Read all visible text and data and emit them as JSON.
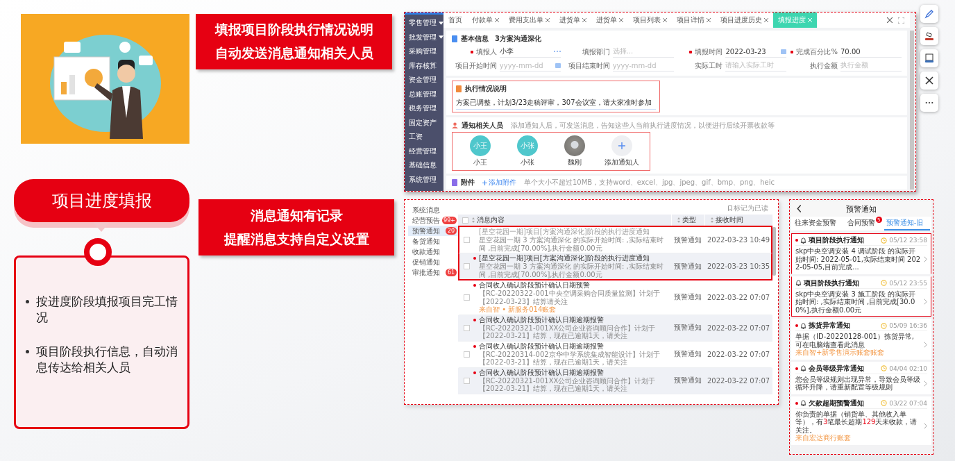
{
  "feature": {
    "title": "项目进度填报",
    "bullets": [
      "按进度阶段填报项目完工情况",
      "项目阶段执行信息，自动消息传达给相关人员"
    ]
  },
  "callouts": [
    {
      "lines": [
        "填报项目阶段执行情况说明",
        "自动发送消息通知相关人员"
      ]
    },
    {
      "lines": [
        "消息通知有记录",
        "提醒消息支持自定义设置"
      ]
    }
  ],
  "progress_app": {
    "sidebar": [
      {
        "label": "零售管理",
        "expandable": true
      },
      {
        "label": "批发管理",
        "expandable": true
      },
      {
        "label": "采购管理",
        "expandable": false
      },
      {
        "label": "库存核算",
        "expandable": false
      },
      {
        "label": "资金管理",
        "expandable": false
      },
      {
        "label": "总账管理",
        "expandable": false
      },
      {
        "label": "税务管理",
        "expandable": false
      },
      {
        "label": "固定资产",
        "expandable": false
      },
      {
        "label": "工资",
        "expandable": false
      },
      {
        "label": "经营管理",
        "expandable": false
      },
      {
        "label": "基础信息",
        "expandable": false
      },
      {
        "label": "系统管理",
        "expandable": false
      }
    ],
    "tabs": [
      {
        "label": "首页",
        "closable": false,
        "selected": false
      },
      {
        "label": "付款单",
        "closable": true,
        "selected": false
      },
      {
        "label": "费用支出单",
        "closable": true,
        "selected": false
      },
      {
        "label": "进货单",
        "closable": true,
        "selected": false
      },
      {
        "label": "进货单",
        "closable": true,
        "selected": false
      },
      {
        "label": "项目列表",
        "closable": true,
        "selected": false
      },
      {
        "label": "项目详情",
        "closable": true,
        "selected": false
      },
      {
        "label": "项目进度历史",
        "closable": true,
        "selected": false
      },
      {
        "label": "填报进度",
        "closable": true,
        "selected": true
      }
    ],
    "basic_info": {
      "title": "基本信息",
      "project": "3方案沟通深化",
      "fields": [
        {
          "label": "填报人",
          "required": true,
          "value": "小李",
          "kind": "picker"
        },
        {
          "label": "填报部门",
          "required": false,
          "placeholder": "选择...",
          "kind": "text"
        },
        {
          "label": "填报时间",
          "required": true,
          "value": "2022-03-23",
          "kind": "date"
        },
        {
          "label": "完成百分比%",
          "required": true,
          "value": "70.00",
          "kind": "text"
        },
        {
          "label": "项目开始时间",
          "required": false,
          "placeholder": "yyyy-mm-dd",
          "kind": "date"
        },
        {
          "label": "项目结束时间",
          "required": false,
          "placeholder": "yyyy-mm-dd",
          "kind": "text"
        },
        {
          "label": "实际工时",
          "required": false,
          "placeholder": "请输入实际工时",
          "kind": "text"
        },
        {
          "label": "执行金额",
          "required": false,
          "placeholder": "执行金额",
          "kind": "text"
        }
      ]
    },
    "execution": {
      "title": "执行情况说明",
      "text": "方案已调整，计划3/23走稿评审，307会议室，请大家准时参加",
      "highlighted": true
    },
    "notify": {
      "title": "通知相关人员",
      "hint": "添加通知人后，可发送消息，告知这些人当前执行进度情况，以便进行后续开票收款等",
      "highlighted": true,
      "people": [
        {
          "kind": "initials",
          "avatar": "小王",
          "name": "小王"
        },
        {
          "kind": "initials",
          "avatar": "小张",
          "name": "小张"
        },
        {
          "kind": "photo",
          "name": "魏刚"
        },
        {
          "kind": "add",
          "name": "添加通知人"
        }
      ]
    },
    "attachments": {
      "title": "附件",
      "link": "添加附件",
      "hint": "单个大小不超过10MB，支持word、excel、jpg、jpeg、gif、bmp、png、heic"
    }
  },
  "messages_app": {
    "sidebar": [
      {
        "label": "系统消息",
        "selected": false
      },
      {
        "label": "经营预告",
        "badge": "99+",
        "selected": false
      },
      {
        "label": "预警通知",
        "badge": "20",
        "selected": true
      },
      {
        "label": "备货通知",
        "selected": false
      },
      {
        "label": "收款通知",
        "selected": false
      },
      {
        "label": "促销通知",
        "selected": false
      },
      {
        "label": "审批通知",
        "badge": "61",
        "selected": false
      }
    ],
    "mark_read": "标记为已读",
    "all_checked": false,
    "columns": [
      "消息内容",
      "类型",
      "接收时间"
    ],
    "rows": [
      {
        "unread": false,
        "checked": false,
        "highlighted": true,
        "title": "[星空花园一期]项目[方案沟通深化]阶段的执行进度通知",
        "body": "星空花园一期 3 方案沟通深化 的实际开始时间: ,实际结束时间 ,目前完成[70.00%],执行金额0.00元",
        "type": "预警通知",
        "time": "2022-03-23 10:49"
      },
      {
        "unread": true,
        "checked": false,
        "highlighted": true,
        "title": "[星空花园一期]项目[方案沟通深化]阶段的执行进度通知",
        "body": "星空花园一期 3 方案沟通深化 的实际开始时间: ,实际结束时间 ,目前完成[70.00%],执行金额0.00元",
        "type": "预警通知",
        "time": "2022-03-23 10:35"
      },
      {
        "unread": true,
        "checked": false,
        "highlighted": false,
        "title": "合同收入确认阶段预计确认日期预警",
        "body": "【RC-20220322-001中央空调采购合同质量监测】计划于【2022-03-23】结算请关注",
        "source": "来自智 • 新服务014账套",
        "type": "预警通知",
        "time": "2022-03-22 07:07"
      },
      {
        "unread": true,
        "checked": false,
        "highlighted": false,
        "title": "合同收入确认阶段预计确认日期逾期报警",
        "body": "【RC-20220321-001XX公司企业咨询顾问合作】计划于【2022-03-21】结算，现在已逾期1天，请关注",
        "type": "预警通知",
        "time": "2022-03-22 07:07"
      },
      {
        "unread": true,
        "checked": false,
        "highlighted": false,
        "title": "合同收入确认阶段预计确认日期逾期报警",
        "body": "【RC-20220314-002京华中学系统集成智能设计】计划于【2022-03-21】结算，现在已逾期1天，请关注",
        "type": "预警通知",
        "time": "2022-03-22 07:07"
      },
      {
        "unread": true,
        "checked": false,
        "highlighted": false,
        "title": "合同收入确认阶段预计确认日期逾期报警",
        "body": "【RC-20220321-001XX公司企业咨询顾问合作】计划于【2022-03-21】结算，现在已逾期1天，请关注",
        "type": "预警通知",
        "time": "2022-03-22 07:07"
      }
    ]
  },
  "phone": {
    "title": "预警通知",
    "tabs": [
      {
        "label": "往来资金预警",
        "selected": false
      },
      {
        "label": "合同预警",
        "badge": "5",
        "selected": false
      },
      {
        "label": "预警通知-旧",
        "selected": true
      }
    ],
    "items": [
      {
        "unread": true,
        "highlighted": true,
        "title": "项目阶段执行通知",
        "time": "05/12 23:58",
        "body": "skp中央空调安装 4 调试阶段 的实际开始时间: 2022-05-01,实际结束时间 2022-05-05,目前完成..."
      },
      {
        "unread": false,
        "highlighted": true,
        "title": "项目阶段执行通知",
        "time": "05/12 23:55",
        "body": "skp中央空调安装 3 施工阶段 的实际开始时间: ,实际结束时间 ,目前完成[30.00%],执行金额0.00元"
      },
      {
        "unread": true,
        "highlighted": false,
        "title": "拣货异常通知",
        "time": "05/09 16:36",
        "body": "单据（ID-20220128-001）拣货异常,可在电脑端查看此消息",
        "source": "来自智+新零售演示账套账套"
      },
      {
        "unread": true,
        "highlighted": false,
        "title": "会员等级异常通知",
        "time": "04/04 02:10",
        "body": "您会员等级规则出现异常，导致会员等级循环升降，请重新配置等级规则"
      },
      {
        "unread": true,
        "highlighted": false,
        "title": "欠款超期预警通知",
        "time": "03/22 07:04",
        "body": "你负责的单据（销货单、其他收入单等），有**3**笔最长超期**129**天未收款，请关注。",
        "source": "来自宏达商行账套"
      }
    ]
  }
}
